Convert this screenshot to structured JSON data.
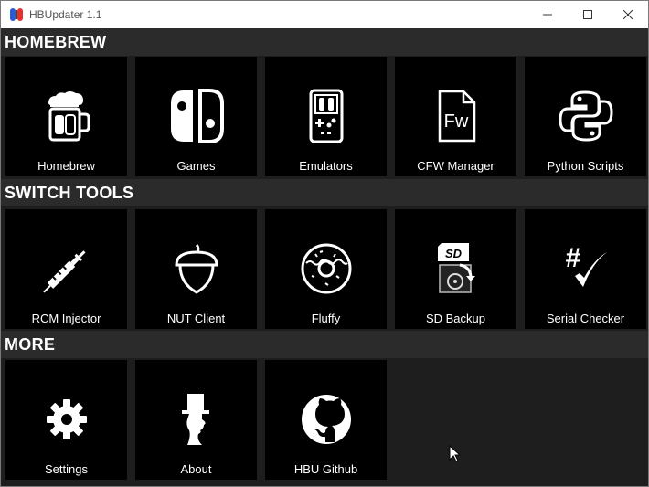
{
  "window": {
    "title": "HBUpdater 1.1"
  },
  "sections": [
    {
      "header": "HOMEBREW",
      "tiles": [
        {
          "label": "Homebrew",
          "icon": "beer-mug-icon"
        },
        {
          "label": "Games",
          "icon": "switch-console-icon"
        },
        {
          "label": "Emulators",
          "icon": "gameboy-icon"
        },
        {
          "label": "CFW Manager",
          "icon": "fw-file-icon"
        },
        {
          "label": "Python Scripts",
          "icon": "python-logo-icon"
        }
      ]
    },
    {
      "header": "SWITCH TOOLS",
      "tiles": [
        {
          "label": "RCM Injector",
          "icon": "syringe-icon"
        },
        {
          "label": "NUT Client",
          "icon": "acorn-icon"
        },
        {
          "label": "Fluffy",
          "icon": "donut-icon"
        },
        {
          "label": "SD Backup",
          "icon": "sd-card-backup-icon"
        },
        {
          "label": "Serial Checker",
          "icon": "hash-check-icon"
        }
      ]
    },
    {
      "header": "MORE",
      "tiles": [
        {
          "label": "Settings",
          "icon": "gear-icon"
        },
        {
          "label": "About",
          "icon": "top-hat-silhouette-icon"
        },
        {
          "label": "HBU Github",
          "icon": "github-icon"
        }
      ]
    }
  ],
  "icons": {
    "sd_card_text": "SD",
    "fw_file_text": "Fw",
    "serial_hash": "#"
  },
  "colors": {
    "background": "#1e1e1e",
    "header_bar": "#2b2b2b",
    "tile": "#000000",
    "text": "#ffffff"
  }
}
